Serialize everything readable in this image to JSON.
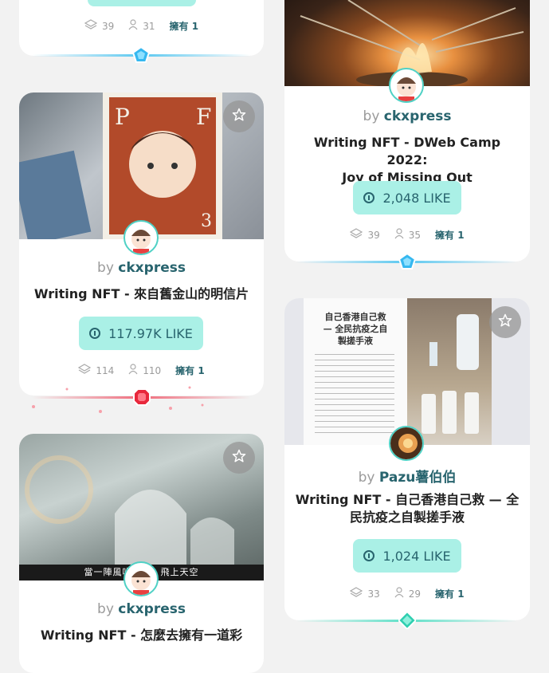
{
  "cards": {
    "top_left": {
      "stats": {
        "editions": "39",
        "collectors": "31",
        "owned": "擁有 1"
      },
      "colors": {
        "glow": "#5bc8f0",
        "gem": "#36b8f0"
      }
    },
    "top_right": {
      "byline_prefix": "by",
      "author": "ckxpress",
      "title": "Writing NFT - DWeb Camp 2022: Joy of Missing Out",
      "title_line1": "Writing NFT - DWeb Camp 2022:",
      "title_line2": "Joy of Missing Out",
      "like": "2,048 LIKE",
      "stats": {
        "editions": "39",
        "collectors": "35",
        "owned": "擁有 1"
      },
      "colors": {
        "glow": "#5bc8f0",
        "gem": "#36b8f0"
      }
    },
    "middle_left": {
      "byline_prefix": "by",
      "author": "ckxpress",
      "title": "Writing NFT - 來自舊金山的明信片",
      "like": "117.97K LIKE",
      "stats": {
        "editions": "114",
        "collectors": "110",
        "owned": "擁有 1"
      },
      "colors": {
        "glow": "#f06c7c",
        "gem": "#e8283c"
      }
    },
    "bottom_right": {
      "byline_prefix": "by",
      "author": "Pazu薯伯伯",
      "title_line1": "Writing NFT - 自己香港自己救 — 全",
      "title_line2": "民抗疫之自製搓手液",
      "like": "1,024 LIKE",
      "stats": {
        "editions": "33",
        "collectors": "29",
        "owned": "擁有 1"
      },
      "colors": {
        "glow": "#5ee0c8",
        "gem": "#2fcfb0"
      },
      "cover_text": {
        "heading_line1": "自己香港自己救",
        "heading_line2": "— 全民抗疫之自",
        "heading_line3": "製搓手液"
      }
    },
    "bottom_left": {
      "byline_prefix": "by",
      "author": "ckxpress",
      "title": "Writing NFT - 怎麼去擁有一道彩",
      "subtitle_caption": "當一陣風吹　　　飛上天空"
    }
  },
  "icons": [
    "layers-icon",
    "user-icon",
    "star-icon",
    "like-coin-icon",
    "gem-icon"
  ]
}
